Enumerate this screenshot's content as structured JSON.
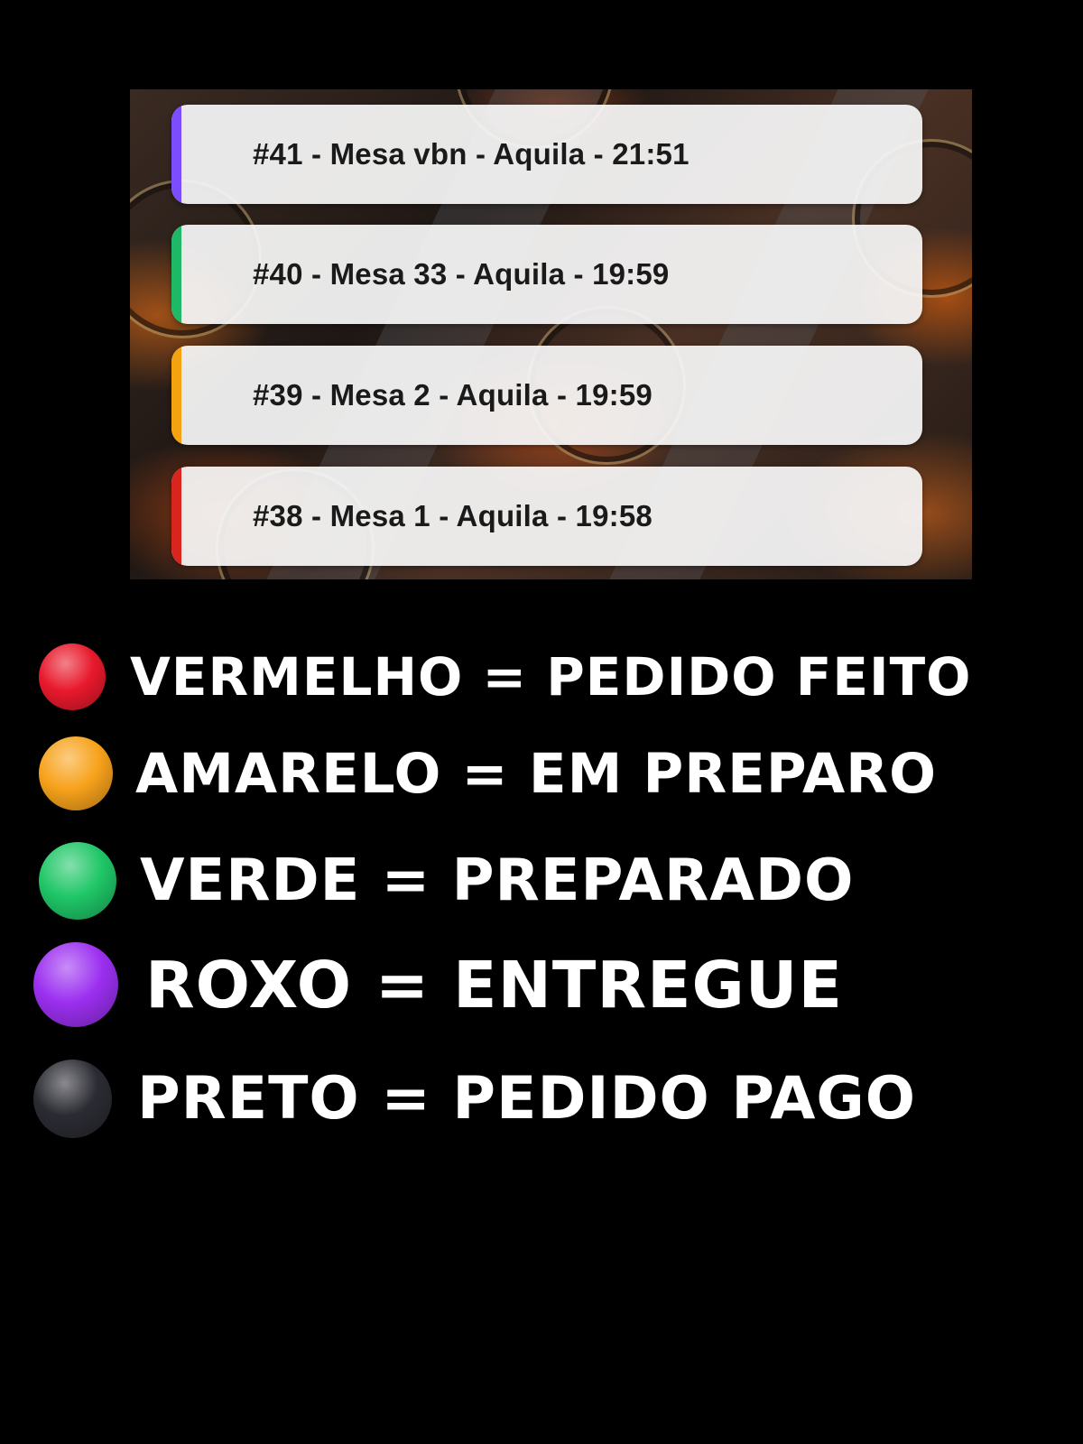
{
  "orders": [
    {
      "label": "#41 - Mesa vbn - Aquila - 21:51",
      "status_color": "#7c4dff"
    },
    {
      "label": "#40 - Mesa 33 - Aquila - 19:59",
      "status_color": "#1fb866"
    },
    {
      "label": "#39 - Mesa 2 - Aquila - 19:59",
      "status_color": "#f2a30f"
    },
    {
      "label": "#38 - Mesa 1 - Aquila - 19:58",
      "status_color": "#d8261f"
    }
  ],
  "legend": [
    {
      "text": "VERMELHO = PEDIDO FEITO",
      "color": "#e8192c",
      "icon": "red-circle-icon"
    },
    {
      "text": "AMARELO = EM PREPARO",
      "color": "#f7a21b",
      "icon": "orange-circle-icon"
    },
    {
      "text": "VERDE = PREPARADO",
      "color": "#1fc667",
      "icon": "green-circle-icon"
    },
    {
      "text": "ROXO = ENTREGUE",
      "color": "#9b2ff0",
      "icon": "purple-circle-icon"
    },
    {
      "text": "PRETO = PEDIDO PAGO",
      "color": "#2b2b33",
      "icon": "black-circle-icon"
    }
  ]
}
